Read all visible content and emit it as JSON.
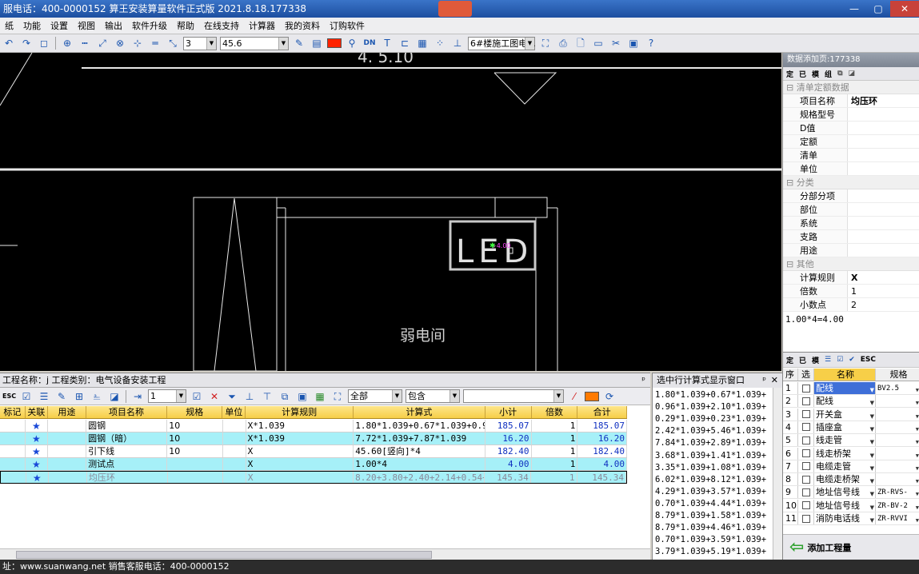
{
  "window": {
    "title": "服电话：400-0000152   算王安装算量软件正式版 2021.8.18.177338",
    "controls": [
      "—",
      "▢",
      "✕"
    ]
  },
  "menu": [
    "纸",
    "功能",
    "设置",
    "视图",
    "输出",
    "软件升级",
    "帮助",
    "在线支持",
    "计算器",
    "我的资料",
    "订购软件"
  ],
  "toolbar": {
    "num_value": "3",
    "num2_value": "45.6",
    "layer_value": "6#楼施工图电..."
  },
  "cad": {
    "top_label": "4. 5.10",
    "led_label": "LED",
    "room_label": "弱电间",
    "marker_label": "+4.00"
  },
  "props_panel": {
    "title": "数据添加页:177338",
    "mini_tools": [
      "定",
      "已",
      "模",
      "组"
    ],
    "sections": [
      {
        "name": "清单定额数据",
        "rows": [
          {
            "k": "项目名称",
            "v": "均压环",
            "bold": true
          },
          {
            "k": "规格型号",
            "v": ""
          },
          {
            "k": "D值",
            "v": ""
          },
          {
            "k": "定额",
            "v": ""
          },
          {
            "k": "清单",
            "v": ""
          },
          {
            "k": "单位",
            "v": ""
          }
        ]
      },
      {
        "name": "分类",
        "rows": [
          {
            "k": "分部分项",
            "v": ""
          },
          {
            "k": "部位",
            "v": ""
          },
          {
            "k": "系统",
            "v": ""
          },
          {
            "k": "支路",
            "v": ""
          },
          {
            "k": "用途",
            "v": ""
          }
        ]
      },
      {
        "name": "其他",
        "rows": [
          {
            "k": "计算规则",
            "v": "X",
            "bold": true
          },
          {
            "k": "倍数",
            "v": "1"
          },
          {
            "k": "小数点",
            "v": "2"
          }
        ]
      }
    ],
    "formula": "1.00*4=4.00"
  },
  "material_panel": {
    "mini_tools": [
      "定",
      "已",
      "模"
    ],
    "columns": [
      "序",
      "选",
      "名称",
      "规格"
    ],
    "rows": [
      {
        "seq": "1",
        "name": "配线",
        "spec": "BV2.5",
        "highlight": true
      },
      {
        "seq": "2",
        "name": "配线",
        "spec": ""
      },
      {
        "seq": "3",
        "name": "开关盒",
        "spec": ""
      },
      {
        "seq": "4",
        "name": "插座盒",
        "spec": ""
      },
      {
        "seq": "5",
        "name": "线走管",
        "spec": ""
      },
      {
        "seq": "6",
        "name": "线走桥架",
        "spec": ""
      },
      {
        "seq": "7",
        "name": "电缆走管",
        "spec": ""
      },
      {
        "seq": "8",
        "name": "电缆走桥架",
        "spec": ""
      },
      {
        "seq": "9",
        "name": "地址信号线",
        "spec": "ZR-RVS-"
      },
      {
        "seq": "10",
        "name": "地址信号线",
        "spec": "ZR-BV-2"
      },
      {
        "seq": "11",
        "name": "消防电话线",
        "spec": "ZR-RVVI"
      }
    ],
    "add_button": "添加工程量"
  },
  "project_panel": {
    "title": "工程名称：j 工程类别：电气设备安装工程",
    "pin": "ᵖ",
    "toolbar": {
      "count": "1",
      "filter1": "全部",
      "filter2": "包含",
      "search": ""
    },
    "columns": [
      "标记",
      "关联",
      "用途",
      "项目名称",
      "规格",
      "单位",
      "计算规则",
      "计算式",
      "小计",
      "倍数",
      "合计"
    ],
    "rows": [
      {
        "mark": "",
        "rel": "★",
        "use": "",
        "name": "圆钢",
        "spec": "10",
        "unit": "",
        "rule": "X*1.039",
        "formula": "1.80*1.039+0.67*1.039+0.96*1",
        "sub": "185.07",
        "mult": "1",
        "total": "185.07",
        "style": ""
      },
      {
        "mark": "",
        "rel": "★",
        "use": "",
        "name": "圆钢（暗）",
        "spec": "10",
        "unit": "",
        "rule": "X*1.039",
        "formula": "7.72*1.039+7.87*1.039",
        "sub": "16.20",
        "mult": "1",
        "total": "16.20",
        "style": "cyan"
      },
      {
        "mark": "",
        "rel": "★",
        "use": "",
        "name": "引下线",
        "spec": "10",
        "unit": "",
        "rule": "X",
        "formula": "45.60[竖向]*4",
        "sub": "182.40",
        "mult": "1",
        "total": "182.40",
        "style": ""
      },
      {
        "mark": "",
        "rel": "★",
        "use": "",
        "name": "测试点",
        "spec": "",
        "unit": "",
        "rule": "X",
        "formula": "1.00*4",
        "sub": "4.00",
        "mult": "1",
        "total": "4.00",
        "style": "cyan"
      },
      {
        "mark": "",
        "rel": "★",
        "use": "",
        "name": "均压环",
        "spec": "",
        "unit": "",
        "rule": "X",
        "formula": "8.20+3.80+2.40+2.14+0.54+2.9",
        "sub": "145.34",
        "mult": "1",
        "total": "145.34",
        "style": "sel"
      }
    ]
  },
  "formula_window": {
    "title": "选中行计算式显示窗口",
    "pin": "ᵖ",
    "close": "✕",
    "lines": [
      "1.80*1.039+0.67*1.039+",
      "0.96*1.039+2.10*1.039+",
      "0.29*1.039+0.23*1.039+",
      "2.42*1.039+5.46*1.039+",
      "7.84*1.039+2.89*1.039+",
      "3.68*1.039+1.41*1.039+",
      "3.35*1.039+1.08*1.039+",
      "6.02*1.039+8.12*1.039+",
      "4.29*1.039+3.57*1.039+",
      "0.70*1.039+4.44*1.039+",
      "8.79*1.039+1.58*1.039+",
      "8.79*1.039+4.46*1.039+",
      "0.70*1.039+3.59*1.039+",
      "3.79*1.039+5.19*1.039+"
    ]
  },
  "status_bar": "址：www.suanwang.net 销售客服电话：400-0000152"
}
